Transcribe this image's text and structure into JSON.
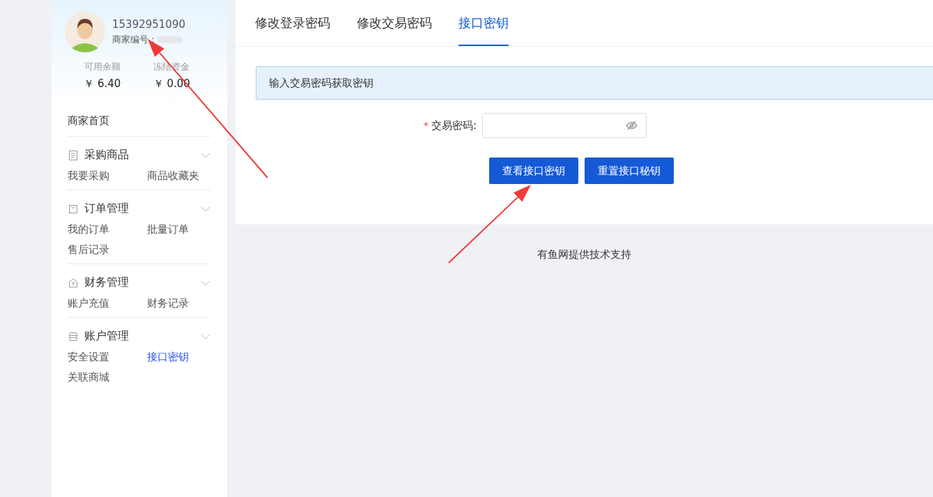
{
  "profile": {
    "phone": "15392951090",
    "merchant_label": "商家编号：",
    "merchant_id_blurred": true
  },
  "balances": [
    {
      "label": "可用余额",
      "value": "￥ 6.40"
    },
    {
      "label": "冻结资金",
      "value": "￥ 0.00"
    }
  ],
  "sidebar": {
    "home": "商家首页",
    "sections": [
      {
        "title": "采购商品",
        "kind": "document",
        "expanded": true,
        "items": [
          {
            "label": "我要采购",
            "selected": false
          },
          {
            "label": "商品收藏夹",
            "selected": false
          }
        ]
      },
      {
        "title": "订单管理",
        "kind": "bag",
        "expanded": true,
        "items": [
          {
            "label": "我的订单",
            "selected": false
          },
          {
            "label": "批量订单",
            "selected": false
          },
          {
            "label": "售后记录",
            "selected": false
          }
        ]
      },
      {
        "title": "财务管理",
        "kind": "house",
        "expanded": true,
        "items": [
          {
            "label": "账户充值",
            "selected": false
          },
          {
            "label": "财务记录",
            "selected": false
          }
        ]
      },
      {
        "title": "账户管理",
        "kind": "store",
        "expanded": true,
        "items": [
          {
            "label": "安全设置",
            "selected": false
          },
          {
            "label": "接口密钥",
            "selected": true
          },
          {
            "label": "关联商城",
            "selected": false
          }
        ]
      }
    ]
  },
  "tabs": [
    {
      "label": "修改登录密码",
      "selected": false
    },
    {
      "label": "修改交易密码",
      "selected": false
    },
    {
      "label": "接口密钥",
      "selected": true
    }
  ],
  "notice": "输入交易密码获取密钥",
  "form": {
    "label": "交易密码:",
    "required_mark": "*",
    "password_hidden": true
  },
  "buttons": [
    "查看接口密钥",
    "重置接口秘钥"
  ],
  "footer": "有鱼网提供技术支持",
  "annotations": [
    {
      "kind": "arrow"
    },
    {
      "kind": "arrow"
    }
  ]
}
